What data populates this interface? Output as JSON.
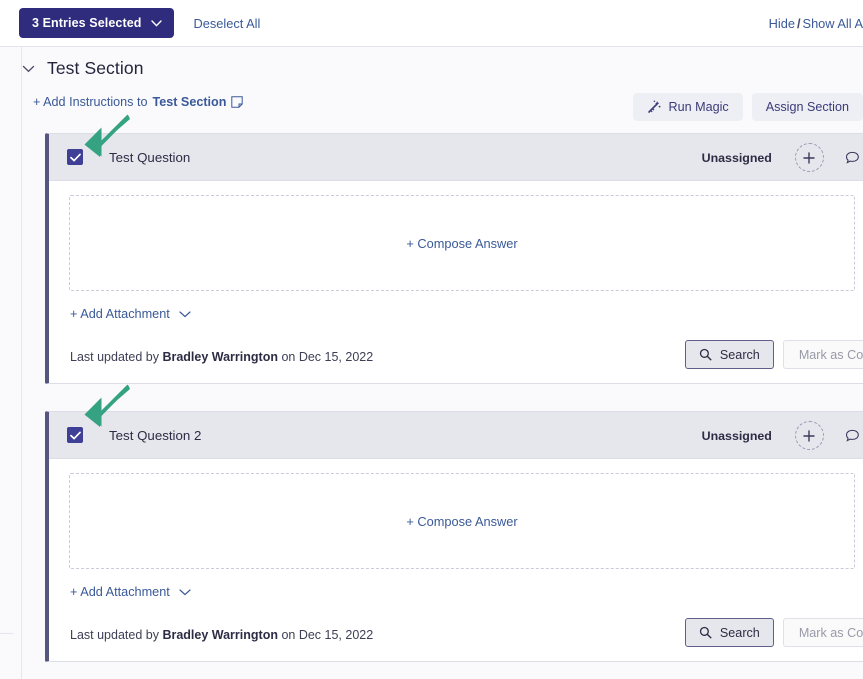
{
  "toolbar": {
    "entries_selected_label": "3 Entries Selected",
    "entries_chevron_icon": "chevron-down-icon",
    "deselect_all_label": "Deselect All",
    "hide_label": "Hide",
    "separator": "/",
    "show_all_label": "Show All A"
  },
  "section": {
    "chevron_icon": "chevron-down-icon",
    "title": "Test Section",
    "add_instructions_prefix": "+ Add Instructions to ",
    "add_instructions_target": "Test Section",
    "note_icon": "note-icon",
    "run_magic_label": "Run Magic",
    "run_magic_icon": "magic-wand-icon",
    "assign_section_label": "Assign Section"
  },
  "common": {
    "compose_answer_label": "+ Compose Answer",
    "add_attachment_label": "+ Add Attachment",
    "add_attachment_chevron_icon": "chevron-down-icon",
    "search_label": "Search",
    "search_icon": "search-icon",
    "mark_complete_label": "Mark as Complete",
    "add_assignee_icon": "plus-icon",
    "comment_icon": "comment-bubble-icon",
    "check_icon": "checkmark-icon",
    "last_updated_prefix": "Last updated by ",
    "last_updated_user": "Bradley Warrington",
    "last_updated_middle": " on ",
    "last_updated_date": "Dec 15, 2022"
  },
  "questions": [
    {
      "title": "Test Question",
      "checked": true,
      "assignee": "Unassigned",
      "comment_count": "0"
    },
    {
      "title": "Test Question 2",
      "checked": true,
      "assignee": "Unassigned",
      "comment_count": "0"
    }
  ],
  "annotations": [
    {
      "type": "arrow",
      "color": "#35a382",
      "points_to": "question-0-checkbox"
    },
    {
      "type": "arrow",
      "color": "#35a382",
      "points_to": "question-1-checkbox"
    }
  ],
  "colors": {
    "primary_navy": "#2f2b7d",
    "link_blue": "#3a5998",
    "checkbox_fill": "#3f3f96",
    "card_header_gray": "#e6e6ed",
    "annotation_green": "#35a382",
    "page_bg": "#fafafc"
  }
}
